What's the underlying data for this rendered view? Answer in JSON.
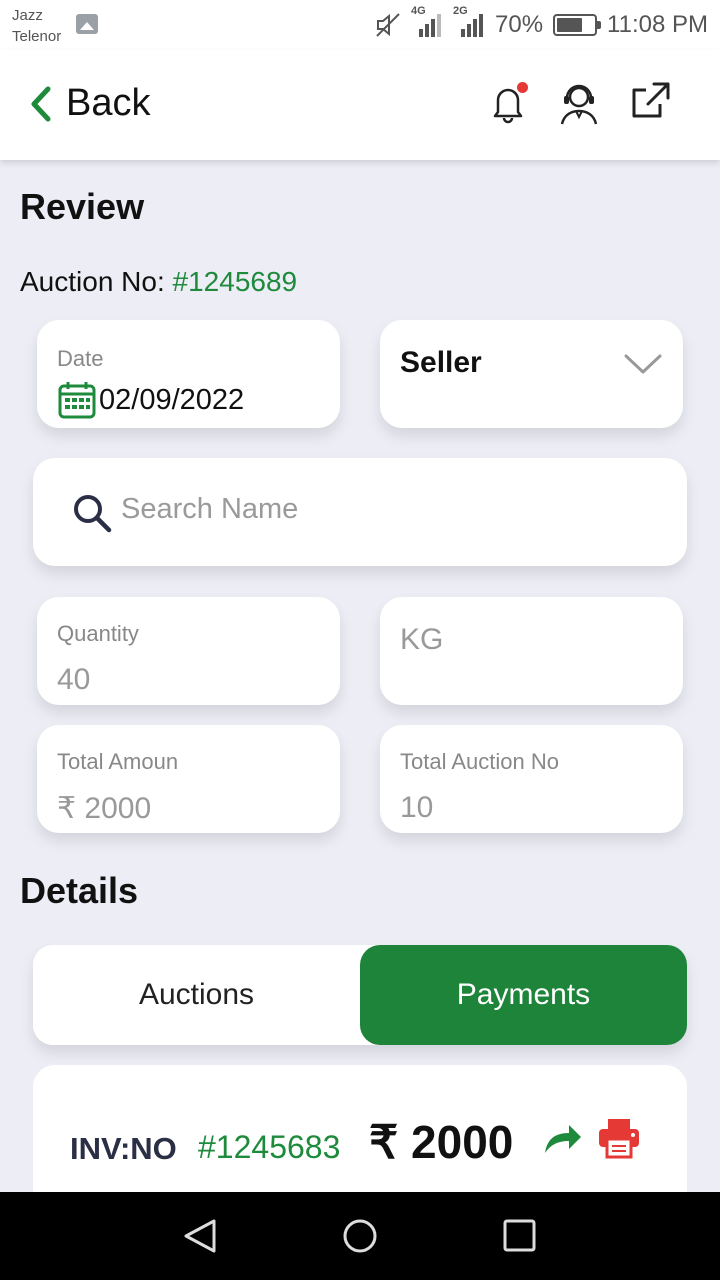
{
  "status_bar": {
    "carrier_line1": "Jazz",
    "carrier_line2": "Telenor",
    "network1": "4G",
    "network2": "2G",
    "battery": "70%",
    "battery_level": 0.7,
    "time": "11:08 PM"
  },
  "header": {
    "back_label": "Back",
    "icons": [
      "bell-icon",
      "support-agent-icon",
      "share-external-icon"
    ],
    "notification_dot_color": "#e53935"
  },
  "review": {
    "title": "Review",
    "auction_label": "Auction No:",
    "auction_number": "#1245689",
    "date_label": "Date",
    "date_value": "02/09/2022",
    "role_select": "Seller",
    "search_placeholder": "Search Name",
    "quantity_label": "Quantity",
    "quantity_value": "40",
    "unit": "KG",
    "total_amount_label": "Total Amoun",
    "total_amount_value": "₹ 2000",
    "total_auction_label": "Total Auction No",
    "total_auction_value": "10"
  },
  "details": {
    "title": "Details",
    "tabs": [
      {
        "label": "Auctions",
        "active": false
      },
      {
        "label": "Payments",
        "active": true
      }
    ],
    "invoice": {
      "label": "INV:NO",
      "number": "#1245683",
      "amount": "₹ 2000"
    }
  },
  "colors": {
    "accent_green": "#1e843a",
    "background": "#ecedf5",
    "print_red": "#e53935"
  }
}
